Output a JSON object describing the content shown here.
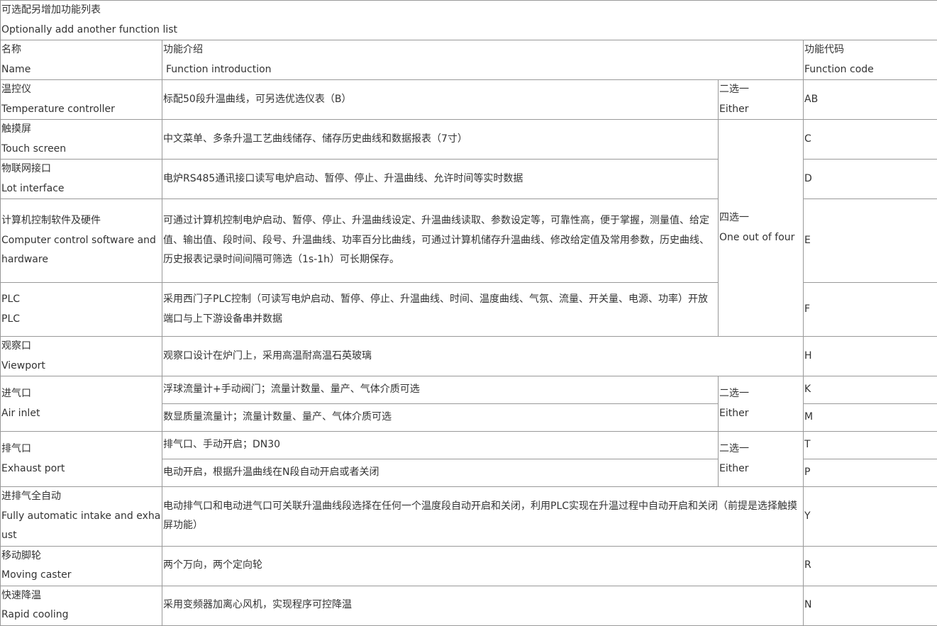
{
  "table": {
    "caption": {
      "zh": "可选配另增加功能列表",
      "en": "Optionally add another function list"
    },
    "header": {
      "name": {
        "zh": "名称",
        "en": "Name"
      },
      "intro": {
        "zh": "功能介绍",
        "en": "Function introduction"
      },
      "code": {
        "zh": "功能代码",
        "en": "Function code"
      }
    },
    "rows": {
      "temperature_controller": {
        "name_zh": "温控仪",
        "name_en": "Temperature controller",
        "intro": "标配50段升温曲线，可另选优选仪表（B）",
        "choice_zh": "二选一",
        "choice_en": "Either",
        "code": "AB"
      },
      "touch_screen": {
        "name_zh": "触摸屏",
        "name_en": "Touch screen",
        "intro": "中文菜单、多条升温工艺曲线储存、储存历史曲线和数据报表（7寸）",
        "code": "C"
      },
      "lot_interface": {
        "name_zh": "物联网接口",
        "name_en": "Lot interface",
        "intro": "电炉RS485通讯接口读写电炉启动、暂停、停止、升温曲线、允许时间等实时数据",
        "code": "D"
      },
      "four_choice": {
        "zh": "四选一",
        "en": "One out of four"
      },
      "computer_control": {
        "name_zh": "计算机控制软件及硬件",
        "name_en": "Computer control software and hardware",
        "intro": "可通过计算机控制电炉启动、暂停、停止、升温曲线设定、升温曲线读取、参数设定等，可靠性高，便于掌握，测量值、给定值、输出值、段时间、段号、升温曲线、功率百分比曲线，可通过计算机储存升温曲线、修改给定值及常用参数，历史曲线、历史报表记录时间间隔可筛选（1s-1h）可长期保存。",
        "code": "E"
      },
      "plc": {
        "name_zh": "PLC",
        "name_en": "PLC",
        "intro": "采用西门子PLC控制（可读写电炉启动、暂停、停止、升温曲线、时间、温度曲线、气氛、流量、开关量、电源、功率）开放端口与上下游设备串并数据",
        "code": "F"
      },
      "viewport": {
        "name_zh": "观察口",
        "name_en": "Viewport",
        "intro": "观察口设计在炉门上，采用高温耐高温石英玻璃",
        "code": "H"
      },
      "air_inlet": {
        "name_zh": "进气口",
        "name_en": "Air inlet",
        "intro_1": "浮球流量计+手动阀门；流量计数量、量产、气体介质可选",
        "intro_2": "数显质量流量计；流量计数量、量产、气体介质可选",
        "choice_zh": "二选一",
        "choice_en": "Either",
        "code_1": "K",
        "code_2": "M"
      },
      "exhaust_port": {
        "name_zh": "排气口",
        "name_en": "Exhaust port",
        "intro_1": "排气口、手动开启；DN30",
        "intro_2": "电动开启，根据升温曲线在N段自动开启或者关闭",
        "choice_zh": "二选一",
        "choice_en": "Either",
        "code_1": "T",
        "code_2": "P"
      },
      "auto_intake_exhaust": {
        "name_zh": "进排气全自动",
        "name_en": "Fully automatic intake and exhaust",
        "intro": "电动排气口和电动进气口可关联升温曲线段选择在任何一个温度段自动开启和关闭，利用PLC实现在升温过程中自动开启和关闭（前提是选择触摸屏功能）",
        "code": "Y"
      },
      "moving_caster": {
        "name_zh": "移动脚轮",
        "name_en": "Moving caster",
        "intro": "两个万向，两个定向轮",
        "code": "R"
      },
      "rapid_cooling": {
        "name_zh": "快速降温",
        "name_en": "Rapid cooling",
        "intro": "采用变频器加离心风机，实现程序可控降温",
        "code": "N"
      }
    }
  }
}
